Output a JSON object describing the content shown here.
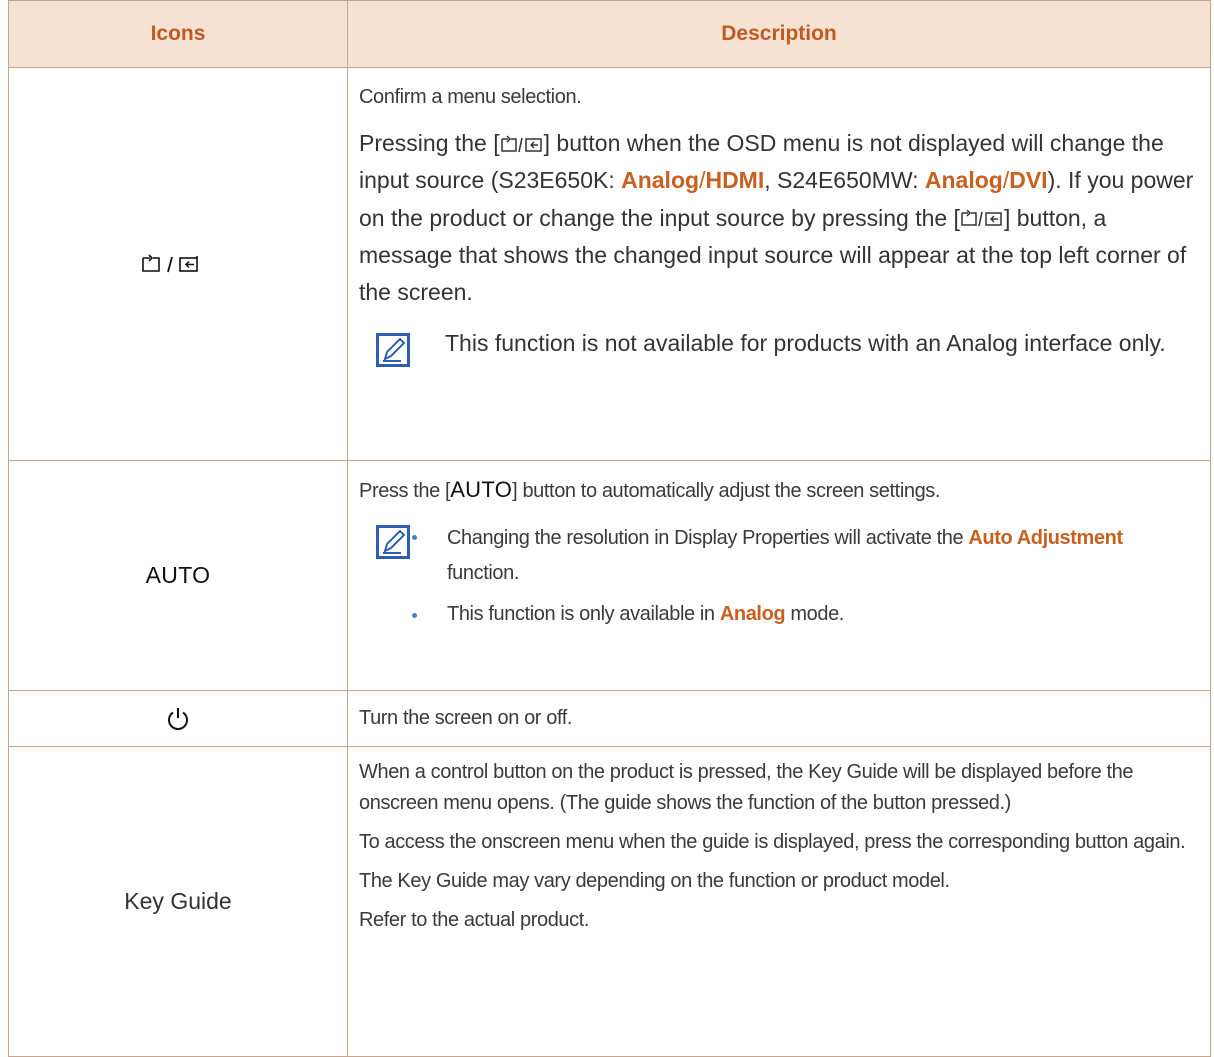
{
  "table": {
    "headers": {
      "icons": "Icons",
      "description": "Description"
    },
    "row_source": {
      "icon_name": "source-enter-icon",
      "confirm_text": "Confirm a menu selection.",
      "press_intro": "Pressing the [",
      "press_mid": "] button when the OSD menu is not displayed will change the input source (S23E650K: ",
      "analog1": "Analog",
      "slash1": "/",
      "hdmi": "HDMI",
      "s24_text": ", S24E650MW: ",
      "analog2": "Analog",
      "slash2": "/",
      "dvi": "DVI",
      "power_text": "). If you power on the product or change the input source by pressing the [",
      "message_text": "] button, a message that shows the changed input source will appear at the top left corner of the screen.",
      "note_text": "This function is not available for products with an Analog interface only."
    },
    "row_auto": {
      "icon_label": "AUTO",
      "press_before": "Press the [",
      "auto_button": "AUTO",
      "press_after": "] button to automatically adjust the screen settings.",
      "bullet1_before": "Changing the resolution in Display Properties will activate the ",
      "bullet1_hl": "Auto Adjustment",
      "bullet1_after": " function.",
      "bullet2_before": "This function is only available in ",
      "bullet2_hl": "Analog",
      "bullet2_after": " mode."
    },
    "row_power": {
      "icon_name": "power-icon",
      "text": "Turn the screen on or off."
    },
    "row_keyguide": {
      "icon_label": "Key Guide",
      "p1": "When a control button on the product is pressed, the Key Guide will be displayed before the onscreen menu opens. (The guide shows the function of the button pressed.)",
      "p2": "To access the onscreen menu when the guide is displayed, press the corresponding button again.",
      "p3": "The Key Guide may vary depending on the function or product model.",
      "p4": "Refer to the actual product."
    }
  },
  "colors": {
    "accent": "#c8601f",
    "header_bg": "#f6e2d2",
    "border": "#c6a48a",
    "bullet": "#4d7fc2"
  }
}
